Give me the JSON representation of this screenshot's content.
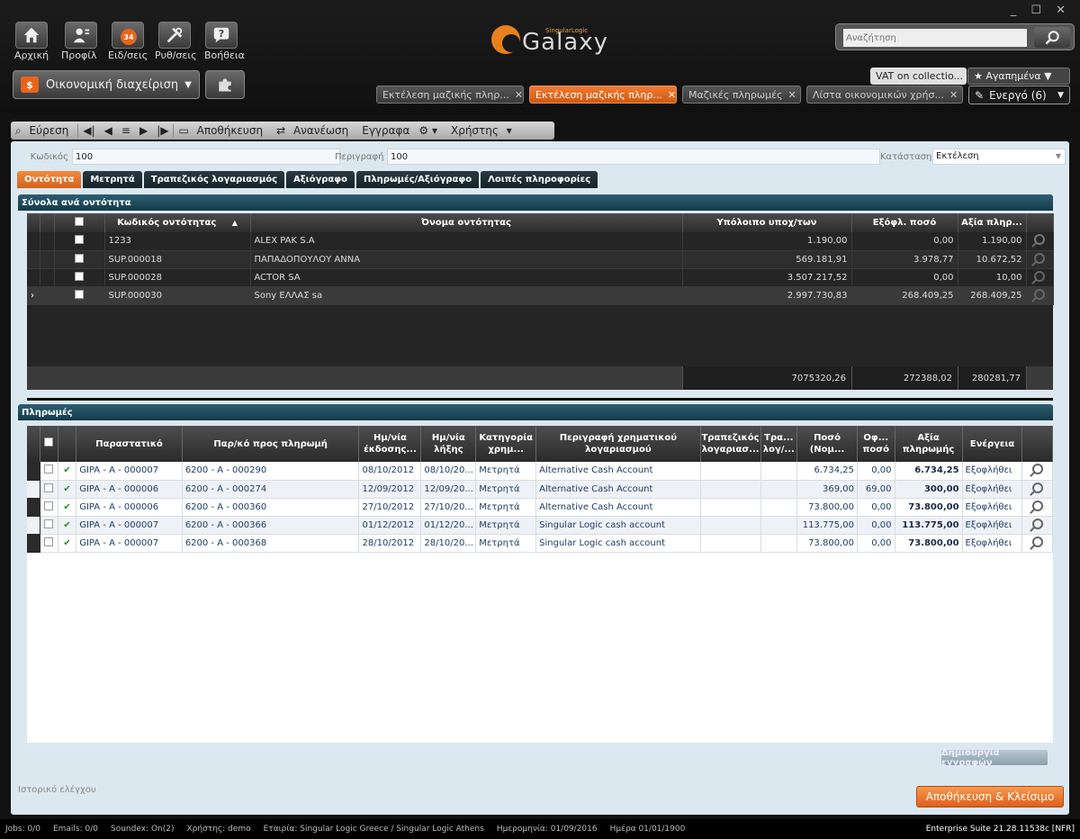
{
  "nav": {
    "home": "Αρχική",
    "profile": "Προφίλ",
    "notifications": "Ειδ/σεις",
    "notifications_count": "34",
    "settings": "Ρυθ/σεις",
    "help": "Βοήθεια"
  },
  "module": "Οικονομική διαχείριση",
  "logo": {
    "brand": "SingularLogic",
    "word": "Galaxy"
  },
  "search": {
    "placeholder": "Αναζήτηση"
  },
  "vat_label": "VAT on collectio...",
  "favorites": "★ Αγαπημένα ▼",
  "doc_tabs": [
    {
      "label": "Εκτέλεση μαζικής πληρ..."
    },
    {
      "label": "Εκτέλεση μαζικής πληρ..."
    },
    {
      "label": "Μαζικές πληρωμές"
    },
    {
      "label": "Λίστα οικονομικών χρήσ..."
    }
  ],
  "active_label": "Ενεργό (6)",
  "toolbar": {
    "find": "Εύρεση",
    "save": "Αποθήκευση",
    "refresh": "Ανανέωση",
    "documents": "Εγγραφα",
    "user": "Χρήστης"
  },
  "form": {
    "code_label": "Κωδικός",
    "code_value": "100",
    "desc_label": "Περιγραφή",
    "desc_value": "100",
    "status_label": "Κατάσταση",
    "status_value": "Εκτέλεση"
  },
  "tabs": [
    "Οντότητα",
    "Μετρητά",
    "Τραπεζικός λογαριασμός",
    "Αξιόγραφο",
    "Πληρωμές/Αξιόγραφο",
    "Λοιπές πληροφορίες"
  ],
  "entities": {
    "title": "Σύνολα ανά οντότητα",
    "headers": {
      "code": "Κωδικός οντότητας",
      "name": "Όνομα οντότητας",
      "balance": "Υπόλοιπο υποχ/των",
      "settled": "Εξόφλ. ποσό",
      "value": "Αξία πληρ..."
    },
    "rows": [
      {
        "code": "1233",
        "name": "ALEX PAK S.A",
        "balance": "1.190,00",
        "settled": "0,00",
        "value": "1.190,00"
      },
      {
        "code": "SUP.000018",
        "name": "ΠΑΠΑΔΟΠΟΥΛΟΥ ΑΝΝΑ",
        "balance": "569.181,91",
        "settled": "3.978,77",
        "value": "10.672,52"
      },
      {
        "code": "SUP.000028",
        "name": "ACTOR SA",
        "balance": "3.507.217,52",
        "settled": "0,00",
        "value": "10,00"
      },
      {
        "code": "SUP.000030",
        "name": "Sony ΕΛΛΑΣ sa",
        "balance": "2.997.730,83",
        "settled": "268.409,25",
        "value": "268.409,25"
      }
    ],
    "totals": {
      "balance": "7075320,26",
      "settled": "272388,02",
      "value": "280281,77"
    }
  },
  "payments": {
    "title": "Πληρωμές",
    "headers": {
      "doc": "Παραστατικό",
      "ref": "Παρ/κό προς πληρωμή",
      "issue": "Ημ/νία έκδοσης...",
      "due": "Ημ/νία λήξης",
      "cat": "Κατηγορία χρημ...",
      "acct": "Περιγραφή χρηματικού λογαριασμού",
      "bank": "Τραπεζικός λογαριασ...",
      "tra": "Τρα... λογ/...",
      "amount": "Ποσό (Νομ...",
      "off": "Οφ... ποσό",
      "value": "Αξία πληρωμής",
      "action": "Ενέργεια"
    },
    "rows": [
      {
        "doc": "GIPA - A - 000007",
        "ref": "6200 - A - 000290",
        "issue": "08/10/2012",
        "due": "08/10/20...",
        "cat": "Μετρητά",
        "acct": "Alternative Cash Account",
        "amount": "6.734,25",
        "off": "0,00",
        "value": "6.734,25",
        "action": "Εξοφλήθει"
      },
      {
        "doc": "GIPA - A - 000006",
        "ref": "6200 - A - 000274",
        "issue": "12/09/2012",
        "due": "12/09/20...",
        "cat": "Μετρητά",
        "acct": "Alternative Cash Account",
        "amount": "369,00",
        "off": "69,00",
        "value": "300,00",
        "action": "Εξοφλήθει"
      },
      {
        "doc": "GIPA - A - 000006",
        "ref": "6200 - A - 000360",
        "issue": "27/10/2012",
        "due": "27/10/20...",
        "cat": "Μετρητά",
        "acct": "Alternative Cash Account",
        "amount": "73.800,00",
        "off": "0,00",
        "value": "73.800,00",
        "action": "Εξοφλήθει"
      },
      {
        "doc": "GIPA - A - 000007",
        "ref": "6200 - A - 000366",
        "issue": "01/12/2012",
        "due": "01/12/20...",
        "cat": "Μετρητά",
        "acct": "Singular Logic cash account",
        "amount": "113.775,00",
        "off": "0,00",
        "value": "113.775,00",
        "action": "Εξοφλήθει"
      },
      {
        "doc": "GIPA - A - 000007",
        "ref": "6200 - A - 000368",
        "issue": "28/10/2012",
        "due": "28/10/20...",
        "cat": "Μετρητά",
        "acct": "Singular Logic cash account",
        "amount": "73.800,00",
        "off": "0,00",
        "value": "73.800,00",
        "action": "Εξοφλήθει"
      }
    ]
  },
  "create_entries": "Δημιουργία εγγραφών",
  "audit_history": "Ιστορικό ελέγχου",
  "save_close": "Αποθήκευση & Κλείσιμο",
  "status": {
    "jobs": "Jobs: 0/0",
    "emails": "Emails: 0/0",
    "soundex": "Soundex: On(2)",
    "user": "Χρήστης: demo",
    "company": "Εταιρία: Singular Logic Greece / Singular Logic Athens",
    "date1": "Ημερομηνία: 01/09/2016",
    "date2": "Ημέρα 01/01/1900",
    "version": "Enterprise Suite 21.28.11538c [NFR]"
  }
}
